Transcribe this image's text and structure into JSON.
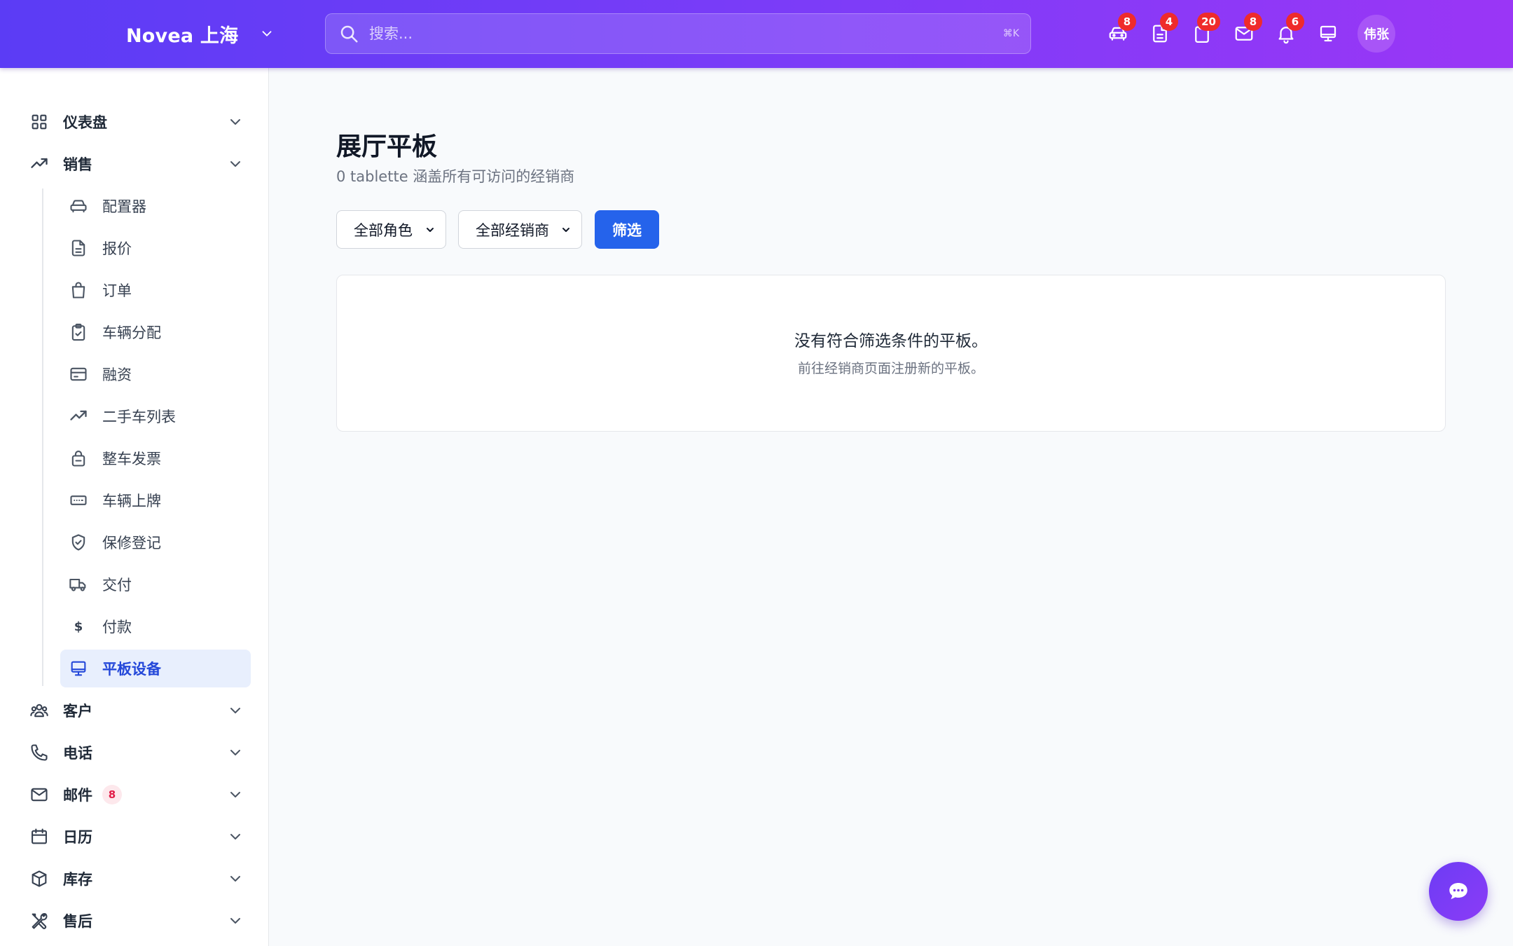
{
  "header": {
    "brand": "Novea 上海",
    "search_placeholder": "搜索...",
    "search_shortcut": "⌘K",
    "icons": [
      {
        "icon": "car-icon",
        "badge": "8"
      },
      {
        "icon": "document-icon",
        "badge": "4"
      },
      {
        "icon": "clipboard-icon",
        "badge": "20"
      },
      {
        "icon": "mail-icon",
        "badge": "8"
      },
      {
        "icon": "bell-icon",
        "badge": "6"
      },
      {
        "icon": "monitor-icon",
        "badge": ""
      }
    ],
    "avatar": "伟张"
  },
  "sidebar": {
    "dashboard": "仪表盘",
    "sales": "销售",
    "sales_items": [
      "配置器",
      "报价",
      "订单",
      "车辆分配",
      "融资",
      "二手车列表",
      "整车发票",
      "车辆上牌",
      "保修登记",
      "交付",
      "付款",
      "平板设备"
    ],
    "payment_symbol": "$",
    "customers": "客户",
    "phone": "电话",
    "mail": "邮件",
    "mail_count": "8",
    "calendar": "日历",
    "inventory": "库存",
    "aftersales": "售后",
    "active_item": "平板设备"
  },
  "main": {
    "title": "展厅平板",
    "subtitle": "0 tablette 涵盖所有可访问的经销商",
    "filters": {
      "role_selected": "全部角色",
      "dealer_selected": "全部经销商",
      "button": "筛选"
    },
    "empty": {
      "title": "没有符合筛选条件的平板。",
      "hint": "前往经销商页面注册新的平板。"
    }
  },
  "colors": {
    "header_gradient_start": "#5b3cf5",
    "header_gradient_end": "#9a36f6",
    "primary_button": "#2563eb",
    "badge_red": "#ef2b2b",
    "active_nav_bg": "#e8effd",
    "active_nav_text": "#2448d9"
  }
}
